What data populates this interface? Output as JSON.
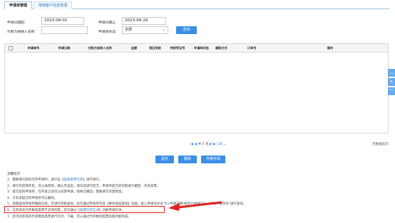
{
  "tabs": [
    {
      "label": "申请单管理",
      "active": true
    },
    {
      "label": "常用客户信息管理",
      "active": false
    }
  ],
  "form": {
    "apply_date_start_label": "申请日期起:",
    "apply_date_start_value": "2023-06-01",
    "apply_date_end_label": "申请日期止:",
    "apply_date_end_value": "2023-06-26",
    "payer_name_label": "付款方纳税人名称:",
    "payer_name_value": "",
    "status_label": "申请单状态:",
    "status_value": "全部",
    "query_button": "查询"
  },
  "table": {
    "headers": [
      "申请单号",
      "申请日期",
      "付款方纳税人名称",
      "金额",
      "是否免税",
      "完税凭证号",
      "申请单状态",
      "缴款方式",
      "订单号",
      "操作"
    ]
  },
  "pager": {
    "text_left": "共",
    "page_count": "0",
    "text_page": "页",
    "prev": "◀",
    "first": "|◀",
    "next": "▶",
    "last": "▶|",
    "page_size": "10",
    "empty_text": "无数据显示"
  },
  "actions": {
    "submit": "提交",
    "delete": "删除",
    "void": "作废申请"
  },
  "tips": {
    "title": "温馨提示:",
    "lines": [
      {
        "pre": "1、需要填写新的代开申请时，请点击【",
        "link": "自助发票代开",
        "post": "】进行填写。"
      },
      {
        "pre": "2、请写完成保存后，可以再修改。确认无误后，请勾选进行提交，申请单提交后可能进行撤回、开具发票。",
        "link": "",
        "post": ""
      },
      {
        "pre": "3、提交后的申请单，在开具之前可以作废申请，如果已撤回，需要填写作废原因。",
        "link": "",
        "post": ""
      },
      {
        "pre": "4、只有未提交的申请单可以删除。",
        "link": "",
        "post": ""
      },
      {
        "pre": "5、如需查询申请单缴款信息，可进行完税查询，也可通过申请单开具【事项进度查询】功能，录入申请流水号\"D+申请日期(格式YYMMDD)+12位申请单号\"进行查询。",
        "link": "",
        "post": ""
      },
      {
        "pre": "6、已开具的代开数电电票不支持作废，您可通过【",
        "link": "发票代开红冲",
        "post": "】功能申请红冲。"
      },
      {
        "pre": "7、您可对开具的代开数电电票进行交付、下载，可以通过代开数电电票处理功能完成。",
        "link": "",
        "post": ""
      }
    ]
  },
  "colors": {
    "accent": "#3a8ee6",
    "highlight": "#e32020"
  }
}
